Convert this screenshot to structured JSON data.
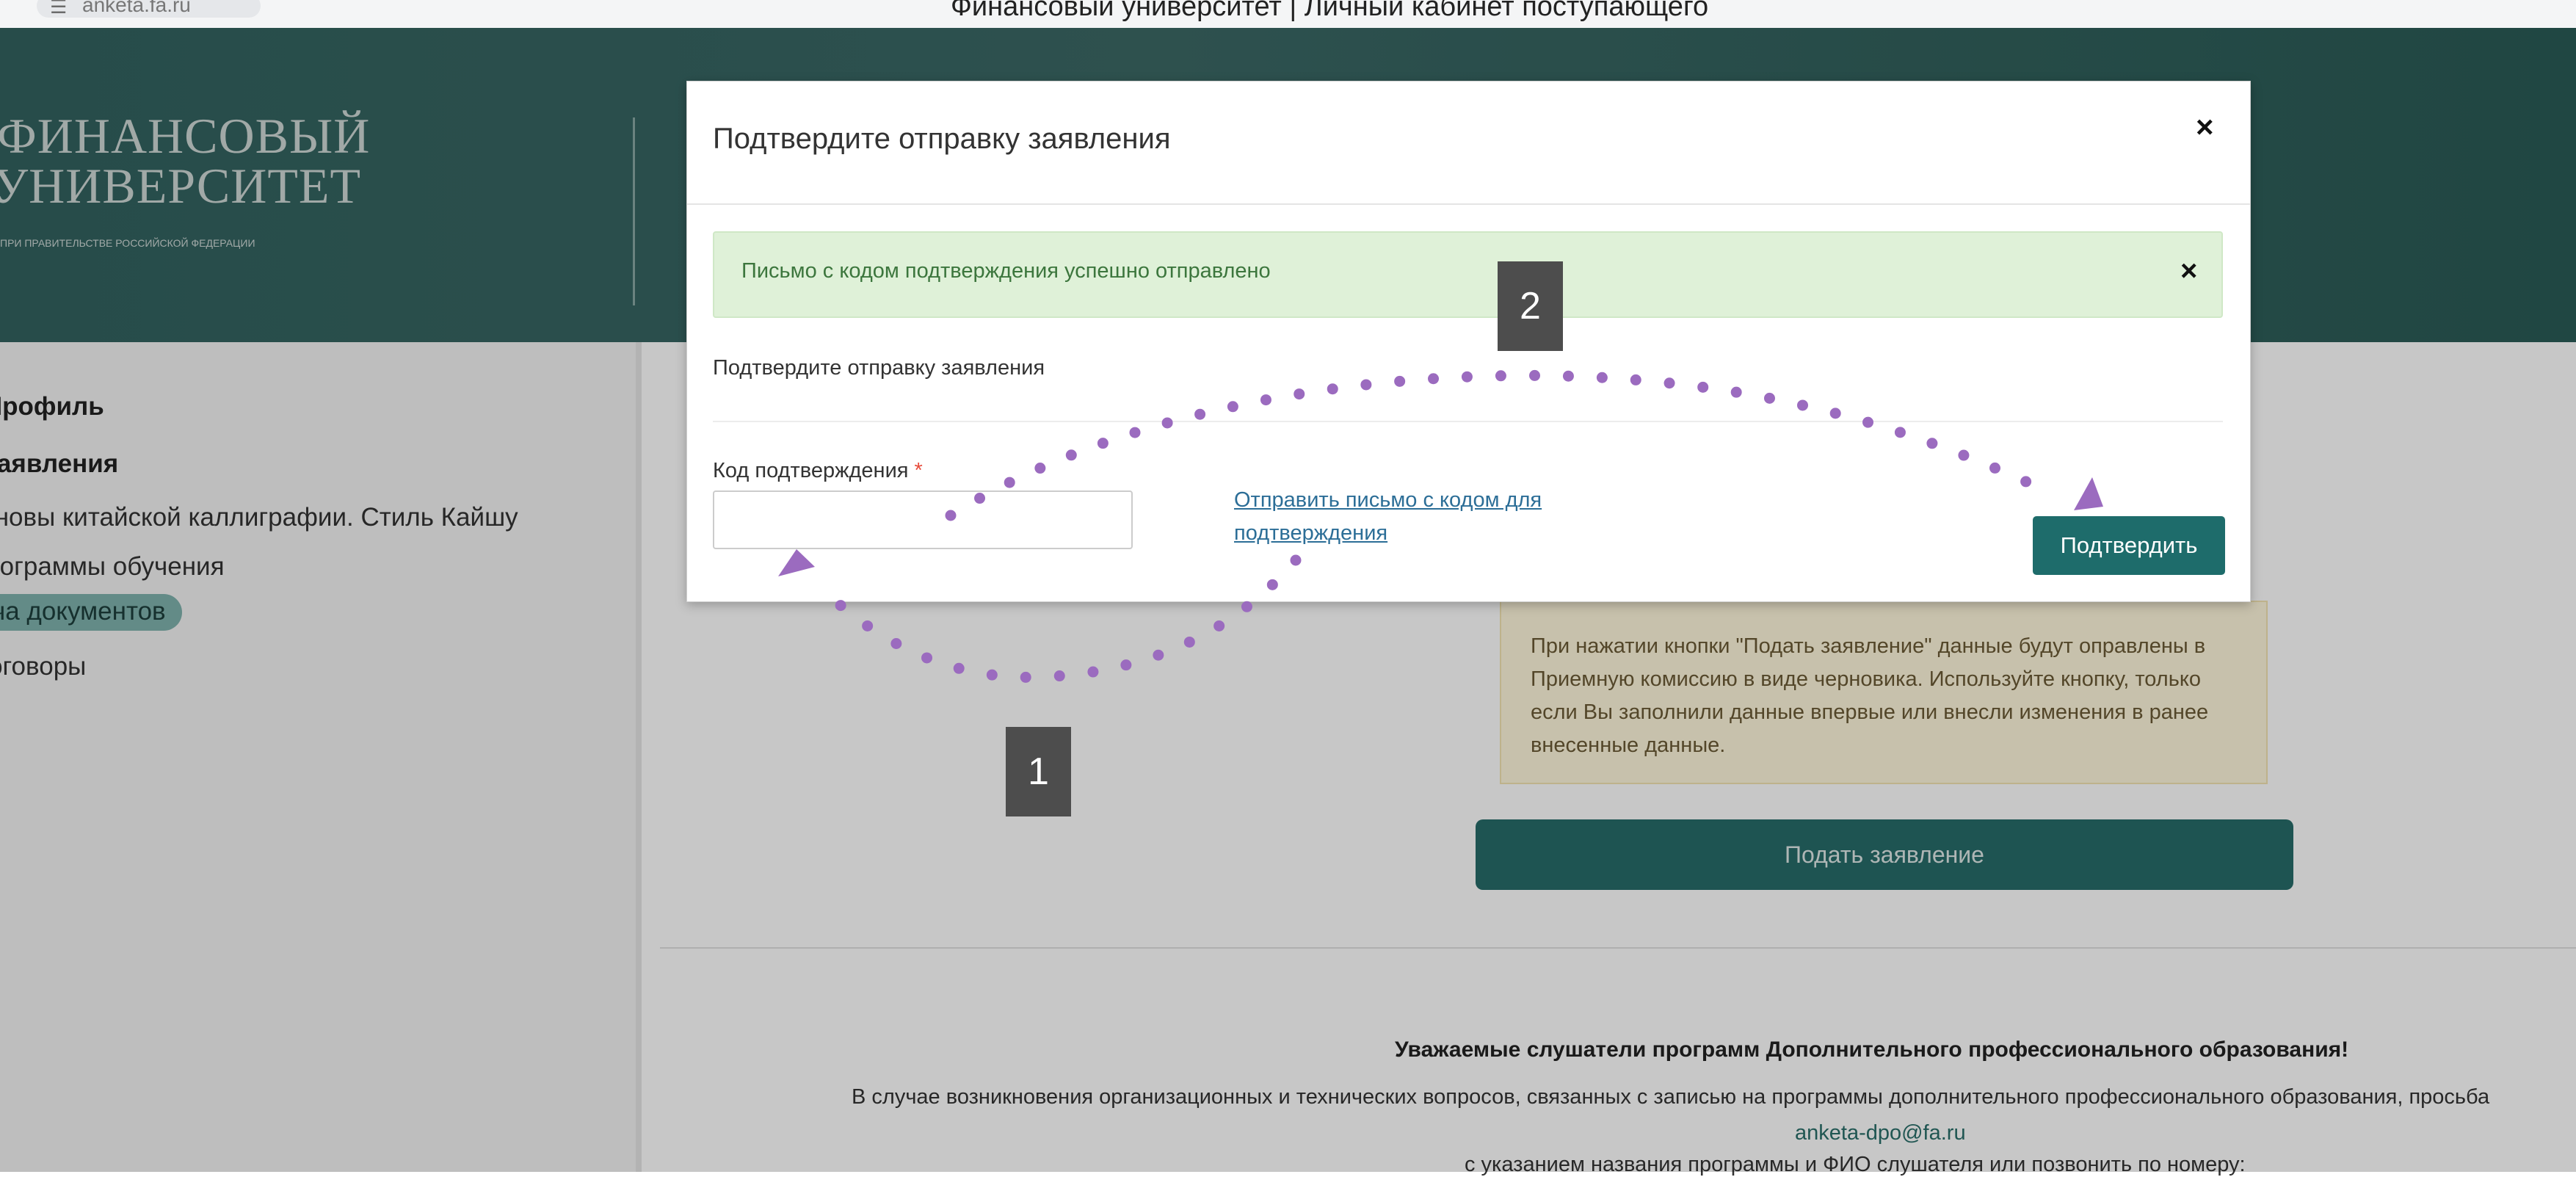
{
  "browser": {
    "url": "anketa.fa.ru",
    "tab_icon": "page-icon",
    "window_title": "Финансовый университет | Личный кабинет поступающего"
  },
  "header": {
    "logo_line1": "ФИНАНСОВЫЙ",
    "logo_line2": "УНИВЕРСИТЕТ",
    "logo_line3": "ПРИ ПРАВИТЕЛЬСТВЕ РОССИЙСКОЙ ФЕДЕРАЦИИ"
  },
  "sidebar": {
    "items": [
      {
        "label": "Профиль"
      },
      {
        "label": "Заявления"
      },
      {
        "label": "Основы китайской каллиграфии. Стиль Кайшу"
      },
      {
        "label": "Программы обучения"
      },
      {
        "label": "Подача документов"
      },
      {
        "label": "Договоры"
      }
    ]
  },
  "main": {
    "info_text": "При нажатии кнопки \"Подать заявление\" данные будут оправлены в Приемную комиссию в виде черновика. Используйте кнопку, только если Вы заполнили данные впервые или внесли изменения в ранее внесенные данные.",
    "submit_label": "Подать заявление",
    "notice_title": "Уважаемые слушатели программ Дополнительного профессионального образования!",
    "notice_text": "В случае возникновения организационных и технических вопросов, связанных с записью на программы дополнительного профессионального образования, просьба",
    "notice_email": "anketa-dpo@fa.ru",
    "notice_text2": "с указанием названия программы и ФИО слушателя или позвонить по номеру:"
  },
  "modal": {
    "title": "Подтвердите отправку заявления",
    "close_glyph": "×",
    "alert_text": "Письмо с кодом подтверждения успешно отправлено",
    "alert_close_glyph": "×",
    "subtitle": "Подтвердите отправку заявления",
    "code_label": "Код подтверждения",
    "required_mark": "*",
    "code_value": "",
    "send_link": "Отправить письмо с кодом для подтверждения",
    "confirm_label": "Подтвердить"
  },
  "annotations": {
    "marker1": "1",
    "marker2": "2",
    "arrow_color": "#9b6bbf"
  },
  "colors": {
    "header_bg": "#35625f",
    "accent": "#1e6c6b",
    "alert_bg": "#dff1d8",
    "alert_text": "#3c763d",
    "info_bg": "#fff8dd",
    "link": "#2c6e97"
  }
}
